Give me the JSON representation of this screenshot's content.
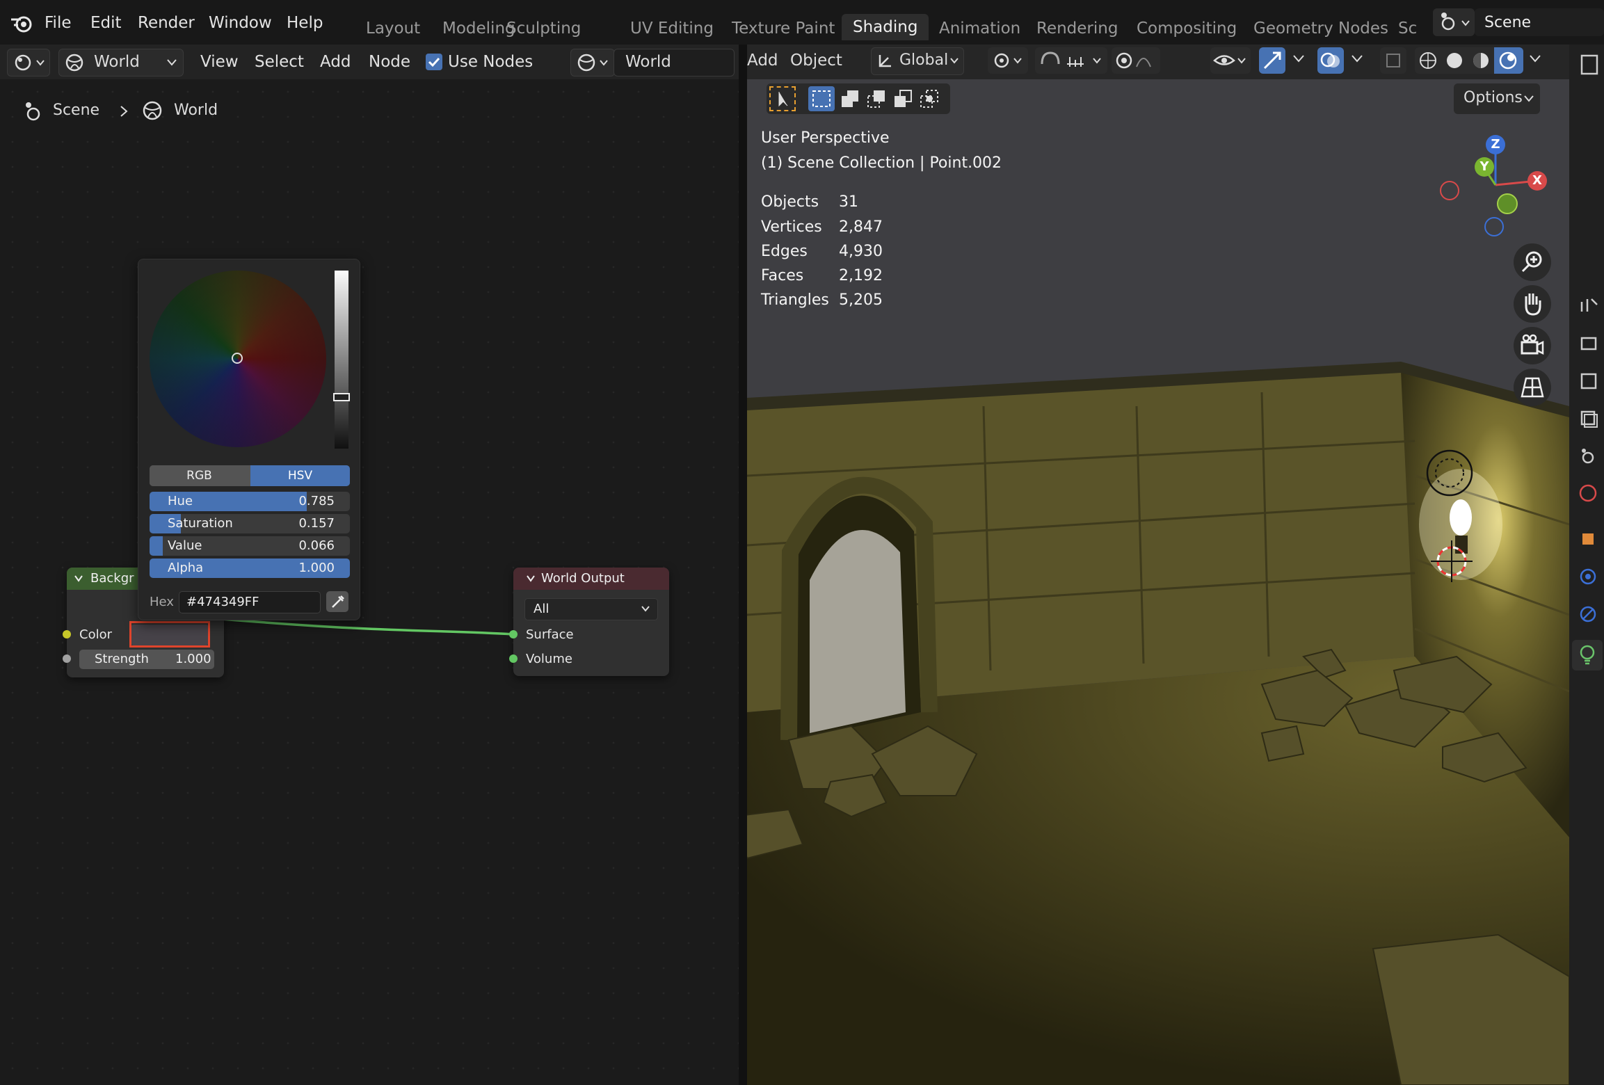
{
  "menu": {
    "file": "File",
    "edit": "Edit",
    "render": "Render",
    "window": "Window",
    "help": "Help"
  },
  "workspaces": [
    "Layout",
    "Modeling",
    "Sculpting",
    "UV Editing",
    "Texture Paint",
    "Shading",
    "Animation",
    "Rendering",
    "Compositing",
    "Geometry Nodes",
    "Sc"
  ],
  "active_workspace": "Shading",
  "scene_selector": "Scene",
  "node_header": {
    "world_dropdown": "World",
    "view": "View",
    "select": "Select",
    "add": "Add",
    "node": "Node",
    "use_nodes": "Use Nodes",
    "world_datablock": "World"
  },
  "breadcrumb": {
    "scene": "Scene",
    "world": "World"
  },
  "color_picker": {
    "mode_rgb": "RGB",
    "mode_hsv": "HSV",
    "hue_label": "Hue",
    "hue_value": "0.785",
    "sat_label": "Saturation",
    "sat_value": "0.157",
    "val_label": "Value",
    "val_value": "0.066",
    "alpha_label": "Alpha",
    "alpha_value": "1.000",
    "hex_label": "Hex",
    "hex_value": "#474349FF",
    "hue": 0.785,
    "saturation": 0.157,
    "value": 0.066,
    "alpha": 1.0
  },
  "background_node": {
    "title": "Backgr",
    "color_label": "Color",
    "strength_label": "Strength",
    "strength_value": "1.000"
  },
  "world_output_node": {
    "title": "World Output",
    "target": "All",
    "surface": "Surface",
    "volume": "Volume"
  },
  "viewport_header": {
    "add": "Add",
    "object": "Object",
    "orientation": "Global",
    "options": "Options"
  },
  "viewport_info": {
    "perspective": "User Perspective",
    "collection": "(1) Scene Collection | Point.002",
    "stats": [
      {
        "label": "Objects",
        "value": "31"
      },
      {
        "label": "Vertices",
        "value": "2,847"
      },
      {
        "label": "Edges",
        "value": "4,930"
      },
      {
        "label": "Faces",
        "value": "2,192"
      },
      {
        "label": "Triangles",
        "value": "5,205"
      }
    ]
  },
  "gizmo": {
    "x": "X",
    "y": "Y",
    "z": "Z"
  },
  "colors": {
    "accent": "#4772b3",
    "shader_header": "#3b5e2f",
    "output_header": "#4a2a30",
    "world_color": "#474349",
    "highlight": "#e0442c"
  }
}
